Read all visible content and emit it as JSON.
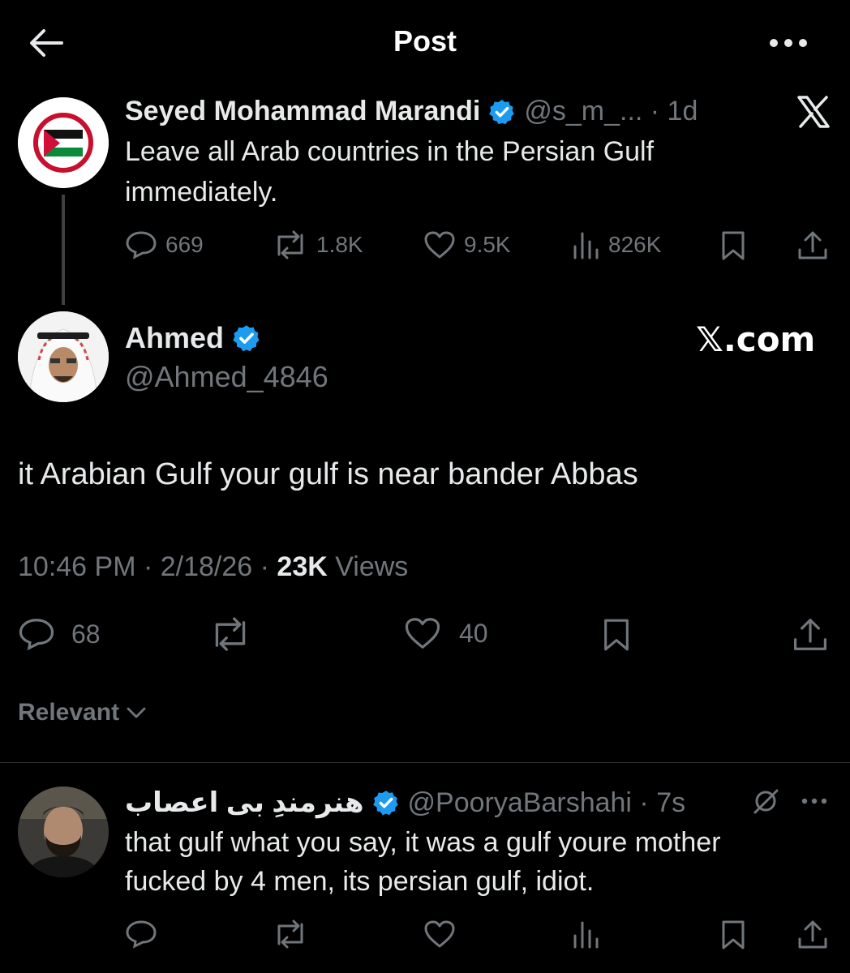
{
  "header": {
    "title": "Post",
    "back_icon": "arrow-left-icon",
    "more_icon": "more-horizontal-icon"
  },
  "quoted_post": {
    "author_name": "Seyed Mohammad Marandi",
    "handle_time": "@s_m_... · 1d",
    "text_line1": "Leave all Arab countries in the Persian Gulf",
    "text_line2": "immediately.",
    "avatar_text_top": "SAVE GAZA",
    "avatar_text_bottom": "SAVE PALESTINE",
    "replies": "669",
    "reposts": "1.8K",
    "likes": "9.5K",
    "views": "826K"
  },
  "main_post": {
    "author_name": "Ahmed",
    "handle": "@Ahmed_4846",
    "watermark": "𝕏.com",
    "text": "it Arabian Gulf your gulf is near bander Abbas",
    "timestamp": "10:46 PM · 2/18/26 · ",
    "views_count": "23K",
    "views_label": " Views",
    "replies": "68",
    "likes": "40"
  },
  "sort": {
    "label": "Relevant"
  },
  "reply": {
    "author_name": "هنرمندِ بی اعصاب",
    "handle_time": "@PooryaBarshahi · 7s",
    "text_line1": "that gulf what you say, it was a gulf youre mother",
    "text_line2": "fucked by 4 men, its persian gulf, idiot."
  },
  "colors": {
    "background": "#000000",
    "text": "#e7e9ea",
    "muted": "#71767b",
    "verified": "#1d9bf0",
    "divider": "#2f3336"
  }
}
